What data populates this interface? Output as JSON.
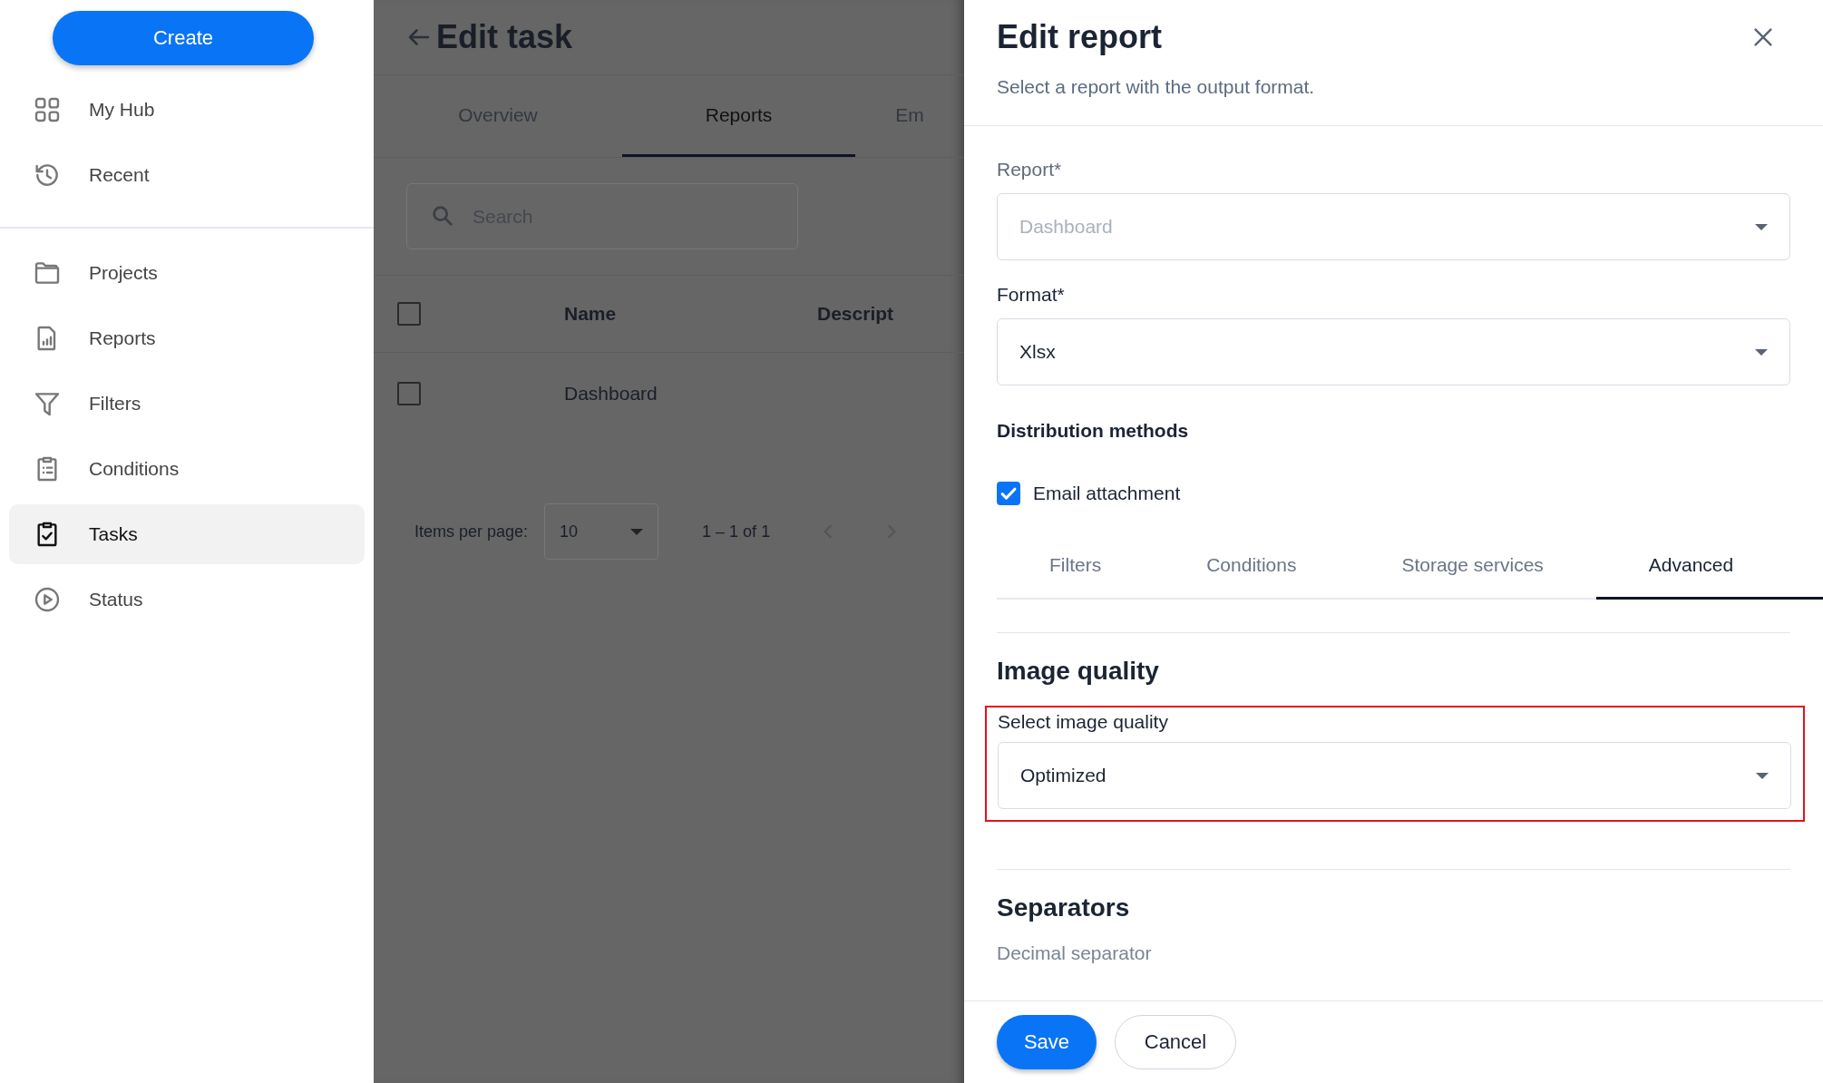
{
  "sidebar": {
    "create_button": "Create",
    "sections": [
      [
        {
          "label": "My Hub",
          "selected": false
        },
        {
          "label": "Recent",
          "selected": false
        }
      ],
      [
        {
          "label": "Projects",
          "selected": false
        },
        {
          "label": "Reports",
          "selected": false
        },
        {
          "label": "Filters",
          "selected": false
        },
        {
          "label": "Conditions",
          "selected": false
        },
        {
          "label": "Tasks",
          "selected": true
        },
        {
          "label": "Status",
          "selected": false
        }
      ]
    ]
  },
  "task_page": {
    "title": "Edit task",
    "tabs": [
      {
        "label": "Overview",
        "selected": false
      },
      {
        "label": "Reports",
        "selected": true
      },
      {
        "label": "Em",
        "selected": false
      }
    ],
    "search": {
      "placeholder": "Search"
    },
    "table": {
      "columns": [
        "Name",
        "Descript"
      ],
      "header_checked": false,
      "rows": [
        {
          "name": "Dashboard",
          "checked": false
        }
      ]
    },
    "pagination": {
      "label": "Items per page:",
      "page_size": "10",
      "range": "1 – 1 of 1"
    }
  },
  "dialog": {
    "title": "Edit report",
    "subtitle": "Select a report with the output format.",
    "fields": [
      {
        "label": "Report*",
        "value": "Dashboard",
        "disabled": true
      },
      {
        "label": "Format*",
        "value": "Xlsx",
        "disabled": false
      }
    ],
    "distribution": {
      "heading": "Distribution methods",
      "options": [
        {
          "label": "Email attachment",
          "checked": true
        }
      ]
    },
    "tabs": [
      {
        "label": "Filters",
        "selected": false
      },
      {
        "label": "Conditions",
        "selected": false
      },
      {
        "label": "Storage services",
        "selected": false
      },
      {
        "label": "Advanced",
        "selected": true
      }
    ],
    "image_quality": {
      "heading": "Image quality",
      "label": "Select image quality",
      "value": "Optimized"
    },
    "separators": {
      "heading": "Separators",
      "label": "Decimal separator"
    },
    "buttons": {
      "save": "Save",
      "cancel": "Cancel"
    }
  }
}
